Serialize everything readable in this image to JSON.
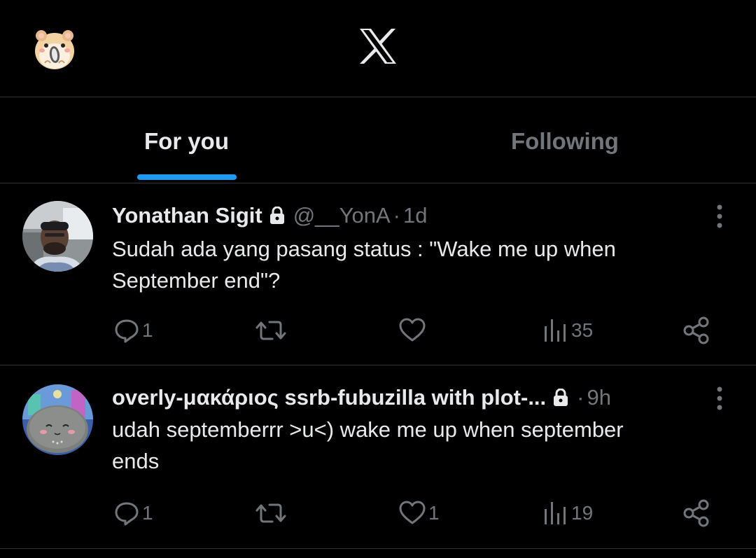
{
  "app": {
    "logo_icon": "x-logo-icon",
    "profile_avatar_icon": "hamster-avatar-icon"
  },
  "tabs": [
    {
      "label": "For you",
      "active": true
    },
    {
      "label": "Following",
      "active": false
    }
  ],
  "colors": {
    "background": "#000000",
    "text_primary": "#e7e9ea",
    "text_secondary": "#71767b",
    "accent": "#1d9bf0",
    "divider": "#2f3336"
  },
  "tweets": [
    {
      "display_name": "Yonathan Sigit",
      "protected_icon": "lock-icon",
      "handle": "@__YonA",
      "separator": "·",
      "time": "1d",
      "text": "Sudah ada yang pasang status : \"Wake me up when\nSeptember end\"?",
      "actions": {
        "reply_count": "1",
        "retweet_count": "",
        "like_count": "",
        "views_count": "35"
      }
    },
    {
      "display_name": "overly-μακάριος ssrb-fubuzilla with plot-...",
      "protected_icon": "lock-icon",
      "handle": "",
      "separator": "·",
      "time": "9h",
      "text": "udah septemberrr >u<) wake me up when september\nends",
      "actions": {
        "reply_count": "1",
        "retweet_count": "",
        "like_count": "1",
        "views_count": "19"
      }
    }
  ]
}
